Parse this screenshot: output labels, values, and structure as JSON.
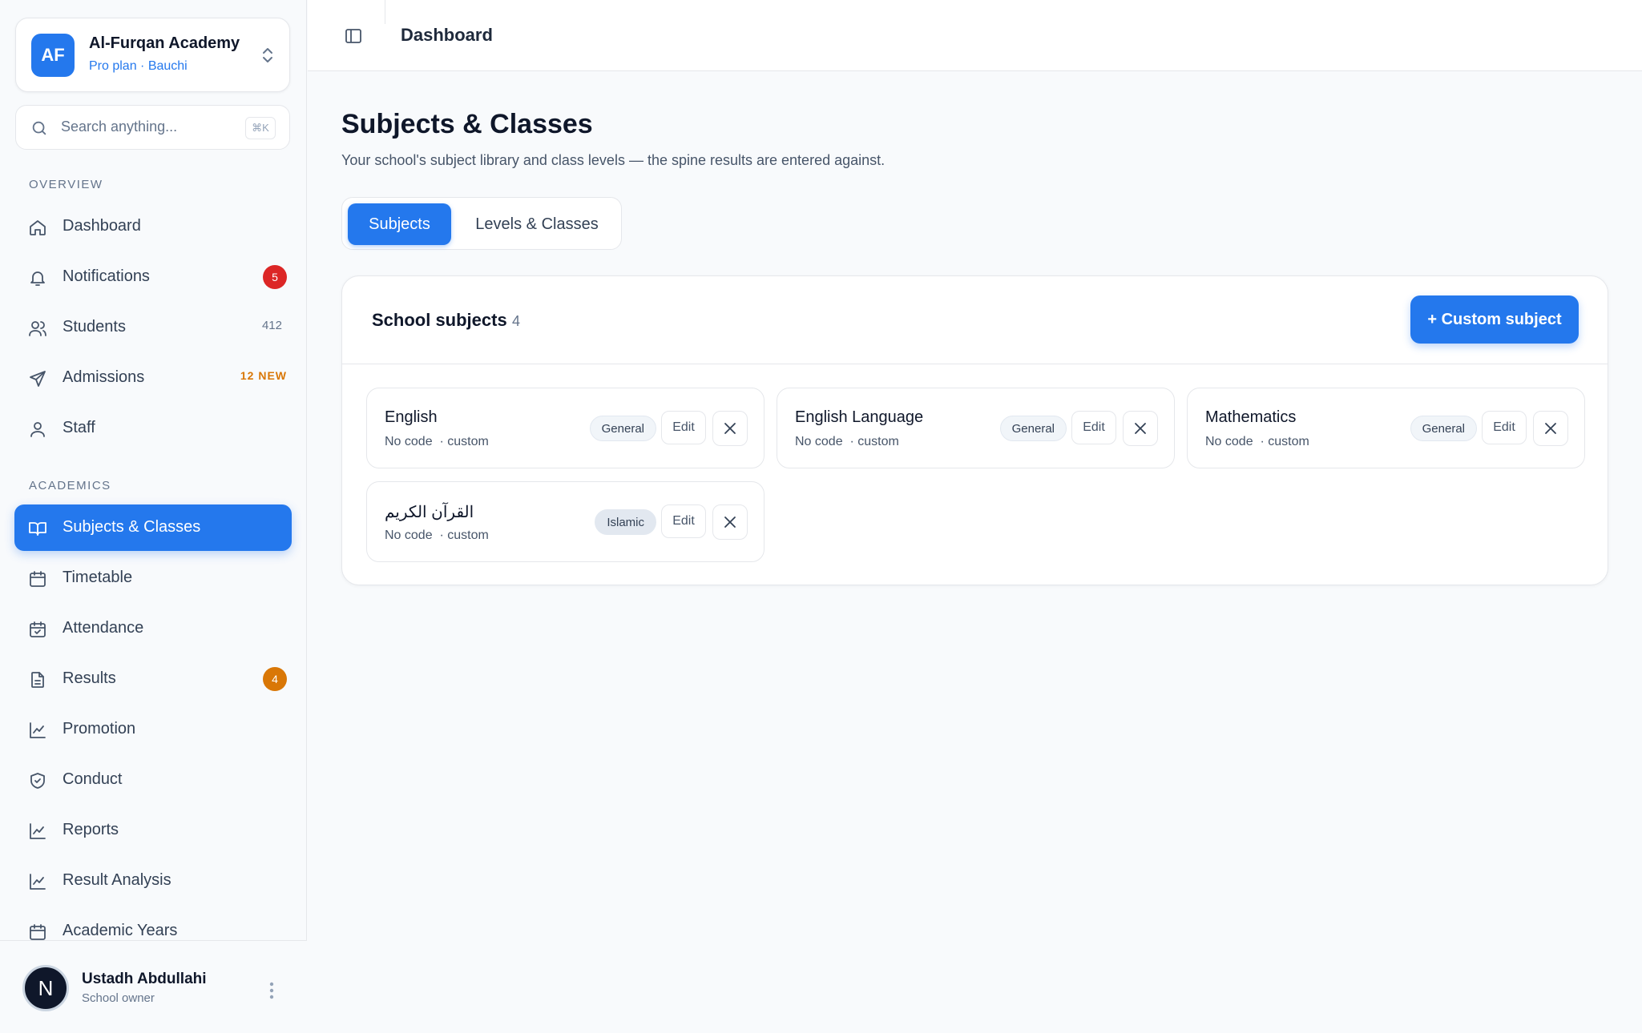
{
  "org": {
    "initials": "AF",
    "name": "Al-Furqan Academy",
    "plan": "Pro plan · Bauchi"
  },
  "search": {
    "placeholder": "Search anything...",
    "shortcut": "⌘K"
  },
  "sidebar": {
    "overview_label": "OVERVIEW",
    "academics_label": "ACADEMICS",
    "items": [
      {
        "label": "Dashboard",
        "icon": "home-icon"
      },
      {
        "label": "Notifications",
        "icon": "bell-icon",
        "badge": "5",
        "badge_color": "#dc2626"
      },
      {
        "label": "Students",
        "icon": "users-icon",
        "count": "412"
      },
      {
        "label": "Admissions",
        "icon": "send-icon",
        "tag": "12 NEW"
      },
      {
        "label": "Staff",
        "icon": "user-icon"
      },
      {
        "label": "Subjects & Classes",
        "icon": "book-icon",
        "active": true
      },
      {
        "label": "Timetable",
        "icon": "calendar-icon"
      },
      {
        "label": "Attendance",
        "icon": "calendar-check-icon"
      },
      {
        "label": "Results",
        "icon": "file-text-icon",
        "badge": "4",
        "badge_color": "#d97706"
      },
      {
        "label": "Promotion",
        "icon": "chart-line-icon"
      },
      {
        "label": "Conduct",
        "icon": "shield-check-icon"
      },
      {
        "label": "Reports",
        "icon": "chart-line-icon"
      },
      {
        "label": "Result Analysis",
        "icon": "chart-line-icon"
      },
      {
        "label": "Academic Years",
        "icon": "calendar-icon"
      }
    ]
  },
  "user": {
    "initial": "N",
    "name": "Ustadh Abdullahi",
    "role": "School owner"
  },
  "topbar": {
    "breadcrumb": "Dashboard"
  },
  "page": {
    "title": "Subjects & Classes",
    "subtitle": "Your school's subject library and class levels — the spine results are entered against.",
    "tabs": [
      "Subjects",
      "Levels & Classes"
    ]
  },
  "panel": {
    "title": "School subjects",
    "count": "4",
    "add_label": "+ Custom subject",
    "edit_label": "Edit",
    "subjects": [
      {
        "name": "English",
        "code": "No code",
        "source": "· custom",
        "category": "General"
      },
      {
        "name": "English Language",
        "code": "No code",
        "source": "· custom",
        "category": "General"
      },
      {
        "name": "Mathematics",
        "code": "No code",
        "source": "· custom",
        "category": "General"
      },
      {
        "name": "القرآن الكريم",
        "code": "No code",
        "source": "· custom",
        "category": "Islamic"
      }
    ]
  },
  "colors": {
    "accent": "#2478ed",
    "danger": "#dc2626",
    "warning": "#d97706"
  }
}
